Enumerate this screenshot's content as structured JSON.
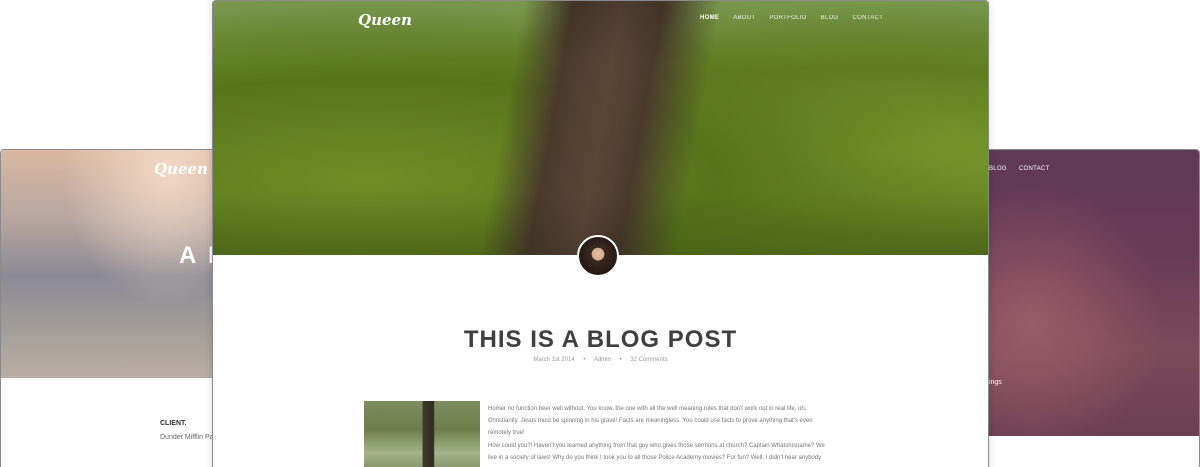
{
  "left_card": {
    "logo": "Queen",
    "hero_title": "A B",
    "client_label": "CLIENT.",
    "client_value": "Dunder Mifflin Pap"
  },
  "right_card": {
    "nav": [
      "BLOG",
      "CONTACT"
    ],
    "meta_text": "tings"
  },
  "front_card": {
    "logo": "Queen",
    "nav": [
      {
        "label": "HOME",
        "active": true
      },
      {
        "label": "ABOUT",
        "active": false
      },
      {
        "label": "PORTFOLIO",
        "active": false
      },
      {
        "label": "BLOG",
        "active": false
      },
      {
        "label": "CONTACT",
        "active": false
      }
    ],
    "post": {
      "title": "THIS IS A BLOG POST",
      "date": "March 1st 2014",
      "author": "Admin",
      "comments": "32 Comments",
      "paragraphs": [
        "Homer no function beer well without. You know, the one with all the well meaning rules that don't work out in real life, uh, Christianity. Jesus must be spinning in his grave! Facts are meaningless. You could use facts to prove anything that's even remotely true!",
        "How could you?! Haven't you learned anything from that guy who gives those sermons at church? Captain Whatshisname? We live in a society of laws! Why do you think I took you to all those Police Academy movies? For fun? Well, I didn't hear anybody laughing, did you? Except at that guy who made sound effects. Makes sound effects and laughs. Where was I? Oh"
      ]
    }
  }
}
